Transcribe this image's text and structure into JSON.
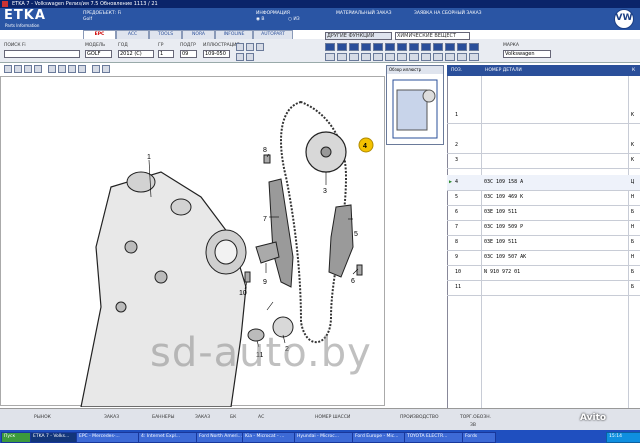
{
  "window": {
    "title": "ETKA 7 - Volkswagen Релиз/ия 7.5 Обновление 1113 / 21"
  },
  "header": {
    "logo": "ETKA",
    "logo_sub": "Parts Information",
    "breadcrumb_1": "ПРЕДОБЪЕКТ: Fi",
    "breadcrumb_2": "Golf",
    "info_label": "ИНФОРМАЦИЯ",
    "info_b": "В",
    "info_iz": "ИЗ",
    "material_order": "МАТЕРИАЛЬНЫЙ ЗАКАЗ",
    "assembly_order": "ЗАЯВКА НА СБОРНЫЙ ЗАКАЗ",
    "vw_logo": "VW"
  },
  "tabs": [
    "EPC",
    "ACC",
    "TOOLS",
    "NORA",
    "INFOLINE",
    "AUTOPART"
  ],
  "toolbar": {
    "search_label": "ПОИСК Fi",
    "model_label": "МОДЕЛЬ",
    "model_value": "GOLF",
    "year_label": "ГОД",
    "year_value": "2012 (C)",
    "group_label": "ГР",
    "group_value": "1",
    "subgroup_label": "ПОДГР",
    "subgroup_value": "09",
    "illustration_label": "ИЛЛЮСТРАЦИЯ",
    "illustration_value": "109-050",
    "other_functions": "ДРУГИЕ ФУНКЦИИ",
    "chemicals": "ХИМИЧЕСКИЕ ВЕЩЕСТ",
    "brand_label": "МАРКА",
    "brand_value": "Volkswagen"
  },
  "thumbnail": {
    "label": "Обзор иллюстр"
  },
  "table": {
    "col_pos": "ПОЗ.",
    "col_part": "НОМЕР ДЕТАЛИ",
    "col_k": "К",
    "rows": [
      {
        "pos": "1",
        "part": "",
        "k": "К"
      },
      {
        "pos": "2",
        "part": "",
        "k": "К"
      },
      {
        "pos": "3",
        "part": "",
        "k": "К"
      },
      {
        "pos": "4",
        "part": "03C 109 158 A",
        "k": "Ц"
      },
      {
        "pos": "5",
        "part": "03C 109 469 K",
        "k": "Н"
      },
      {
        "pos": "6",
        "part": "03E 109 511",
        "k": "Б"
      },
      {
        "pos": "7",
        "part": "03C 109 509 P",
        "k": "Н"
      },
      {
        "pos": "8",
        "part": "03E 109 511",
        "k": "Б"
      },
      {
        "pos": "9",
        "part": "03C 109 507 AK",
        "k": "Н"
      },
      {
        "pos": "10",
        "part": "N  910 972 01",
        "k": "Б"
      },
      {
        "pos": "11",
        "part": "",
        "k": "Б"
      }
    ]
  },
  "diagram": {
    "callouts": [
      "1",
      "2",
      "3",
      "4",
      "5",
      "6",
      "7",
      "8",
      "9",
      "10",
      "11"
    ],
    "highlight": "4"
  },
  "statusbar": {
    "items": [
      "РЫНОК",
      "ЗАКАЗ",
      "БАННЕРЫ",
      "ЗАКАЗ",
      "БК",
      "АС",
      "НОМЕР ШАССИ",
      "ПРОИЗВОДСТВО",
      "ТОРГ.ОБОЗН."
    ],
    "values": [
      "",
      "",
      "",
      "",
      "",
      "",
      "",
      "",
      "ЗВ"
    ]
  },
  "taskbar": {
    "start": "Пуск",
    "tasks": [
      "ETKA 7 - Volks...",
      "EPC - Mercedes-...",
      "4: Internet Expl...",
      "Ford North Ameri...",
      "Kia - Microcat - ...",
      "Hyundai - Microc...",
      "Ford Europe - Mic...",
      "TOYOTA ELECTR...",
      "Fords"
    ],
    "clock": "15:14"
  },
  "watermark": "sd-auto.by",
  "avito": "Avito",
  "colors": {
    "header": "#2a55a4",
    "titlebar": "#0a246a",
    "callout_highlight": "#f4c200",
    "taskbar": "#1f4fbf"
  }
}
